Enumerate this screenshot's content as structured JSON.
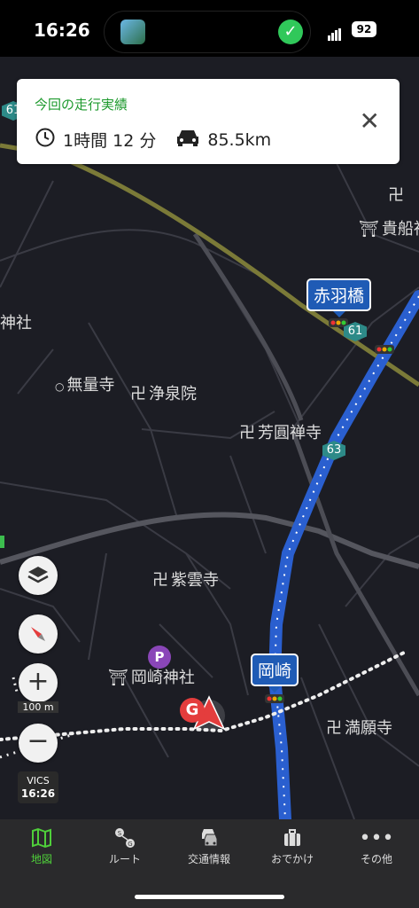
{
  "status_bar": {
    "time": "16:26",
    "battery": "92"
  },
  "card": {
    "title": "今回の走行実績",
    "duration": "1時間 12 分",
    "distance": "85.5km",
    "close_icon": "close-icon"
  },
  "map": {
    "places": {
      "akabanebashi": "赤羽橋",
      "okazaki": "岡崎",
      "muryoji": "無量寺",
      "jousenin": "浄泉院",
      "houenzenji": "芳圓禅寺",
      "shiunji": "紫雲寺",
      "okazaki_jinja": "岡崎神社",
      "manganji": "満願寺",
      "kifune": "貴船神",
      "jinja": "神社"
    },
    "routes": {
      "r61a": "61",
      "r61b": "61",
      "r63": "63"
    },
    "parking": "P",
    "destination": "G",
    "scale": "100 m",
    "vics_label": "VICS",
    "vics_time": "16:26"
  },
  "tabs": [
    {
      "label": "地図",
      "icon": "map-icon"
    },
    {
      "label": "ルート",
      "icon": "route-icon"
    },
    {
      "label": "交通情報",
      "icon": "traffic-icon"
    },
    {
      "label": "おでかけ",
      "icon": "suitcase-icon"
    },
    {
      "label": "その他",
      "icon": "more-icon"
    }
  ],
  "colors": {
    "accent": "#4fcf3a",
    "route": "#1f5bb5",
    "card_title": "#1e9a2e"
  }
}
